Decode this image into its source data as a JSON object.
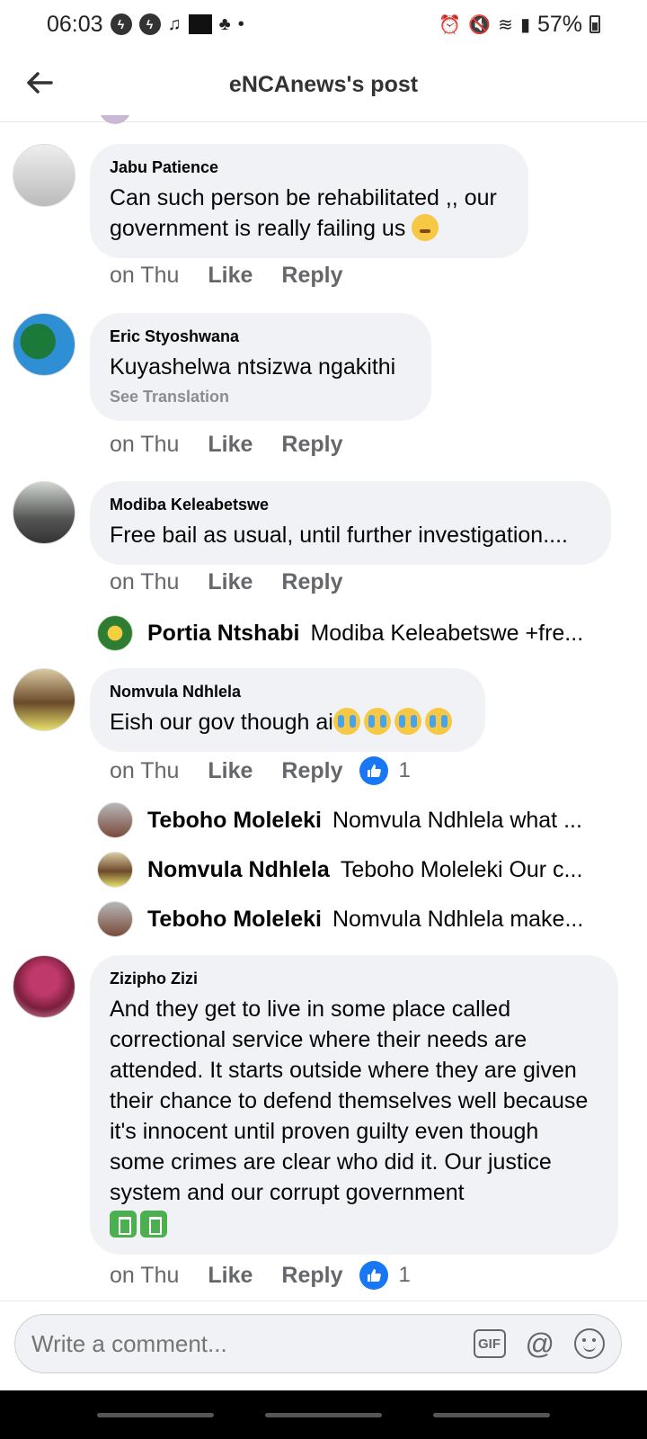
{
  "status_bar": {
    "time": "06:03",
    "battery": "57%"
  },
  "header": {
    "title": "eNCAnews's post"
  },
  "comments": [
    {
      "author": "Jabu Patience",
      "text": "Can such person be rehabilitated ,, our government is really failing us",
      "emoji": "sleepy",
      "time": "on Thu",
      "like": "Like",
      "reply": "Reply"
    },
    {
      "author": "Eric Styoshwana",
      "text": "Kuyashelwa ntsizwa ngakithi",
      "see_translation": "See Translation",
      "time": "on Thu",
      "like": "Like",
      "reply": "Reply"
    },
    {
      "author": "Modiba Keleabetswe",
      "text": "Free bail as usual, until further investigation....",
      "time": "on Thu",
      "like": "Like",
      "reply": "Reply",
      "replies": [
        {
          "author": "Portia Ntshabi",
          "text": "Modiba Keleabetswe +fre..."
        }
      ]
    },
    {
      "author": "Nomvula Ndhlela",
      "text": "Eish our gov though ai",
      "emoji": "cry x4",
      "time": "on Thu",
      "like": "Like",
      "reply": "Reply",
      "like_count": "1",
      "replies": [
        {
          "author": "Teboho Moleleki",
          "text": "Nomvula Ndhlela what ..."
        },
        {
          "author": "Nomvula Ndhlela",
          "text": "Teboho Moleleki Our c..."
        },
        {
          "author": "Teboho Moleleki",
          "text": "Nomvula Ndhlela make..."
        }
      ]
    },
    {
      "author": "Zizipho Zizi",
      "text": "And they get to live in some place called correctional service where their needs are attended. It starts outside where they are given their chance to defend themselves well because it's innocent until  proven guilty even though some crimes are clear who did it. Our justice system and our corrupt government",
      "emoji": "bin x2",
      "time": "on Thu",
      "like": "Like",
      "reply": "Reply",
      "like_count": "1"
    }
  ],
  "composer": {
    "placeholder": "Write a comment...",
    "gif_label": "GIF",
    "at_label": "@"
  }
}
